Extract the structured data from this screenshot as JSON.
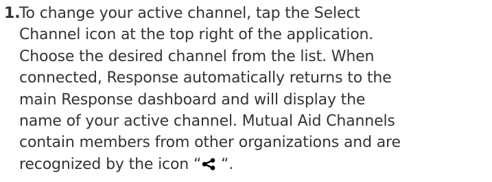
{
  "instruction": {
    "number": "1.",
    "lines": [
      "To change your active channel, tap the Select",
      "Channel icon at the top right of the application.",
      "Choose the desired channel from the list. When",
      "connected, Response automatically returns to the",
      "main Response dashboard and will display the",
      "name of your active channel. Mutual Aid Channels",
      "contain members from other organizations and are"
    ],
    "last_line_before_icon": "recognized by the icon “",
    "last_line_after_icon": " “.",
    "icon": "share-icon"
  }
}
